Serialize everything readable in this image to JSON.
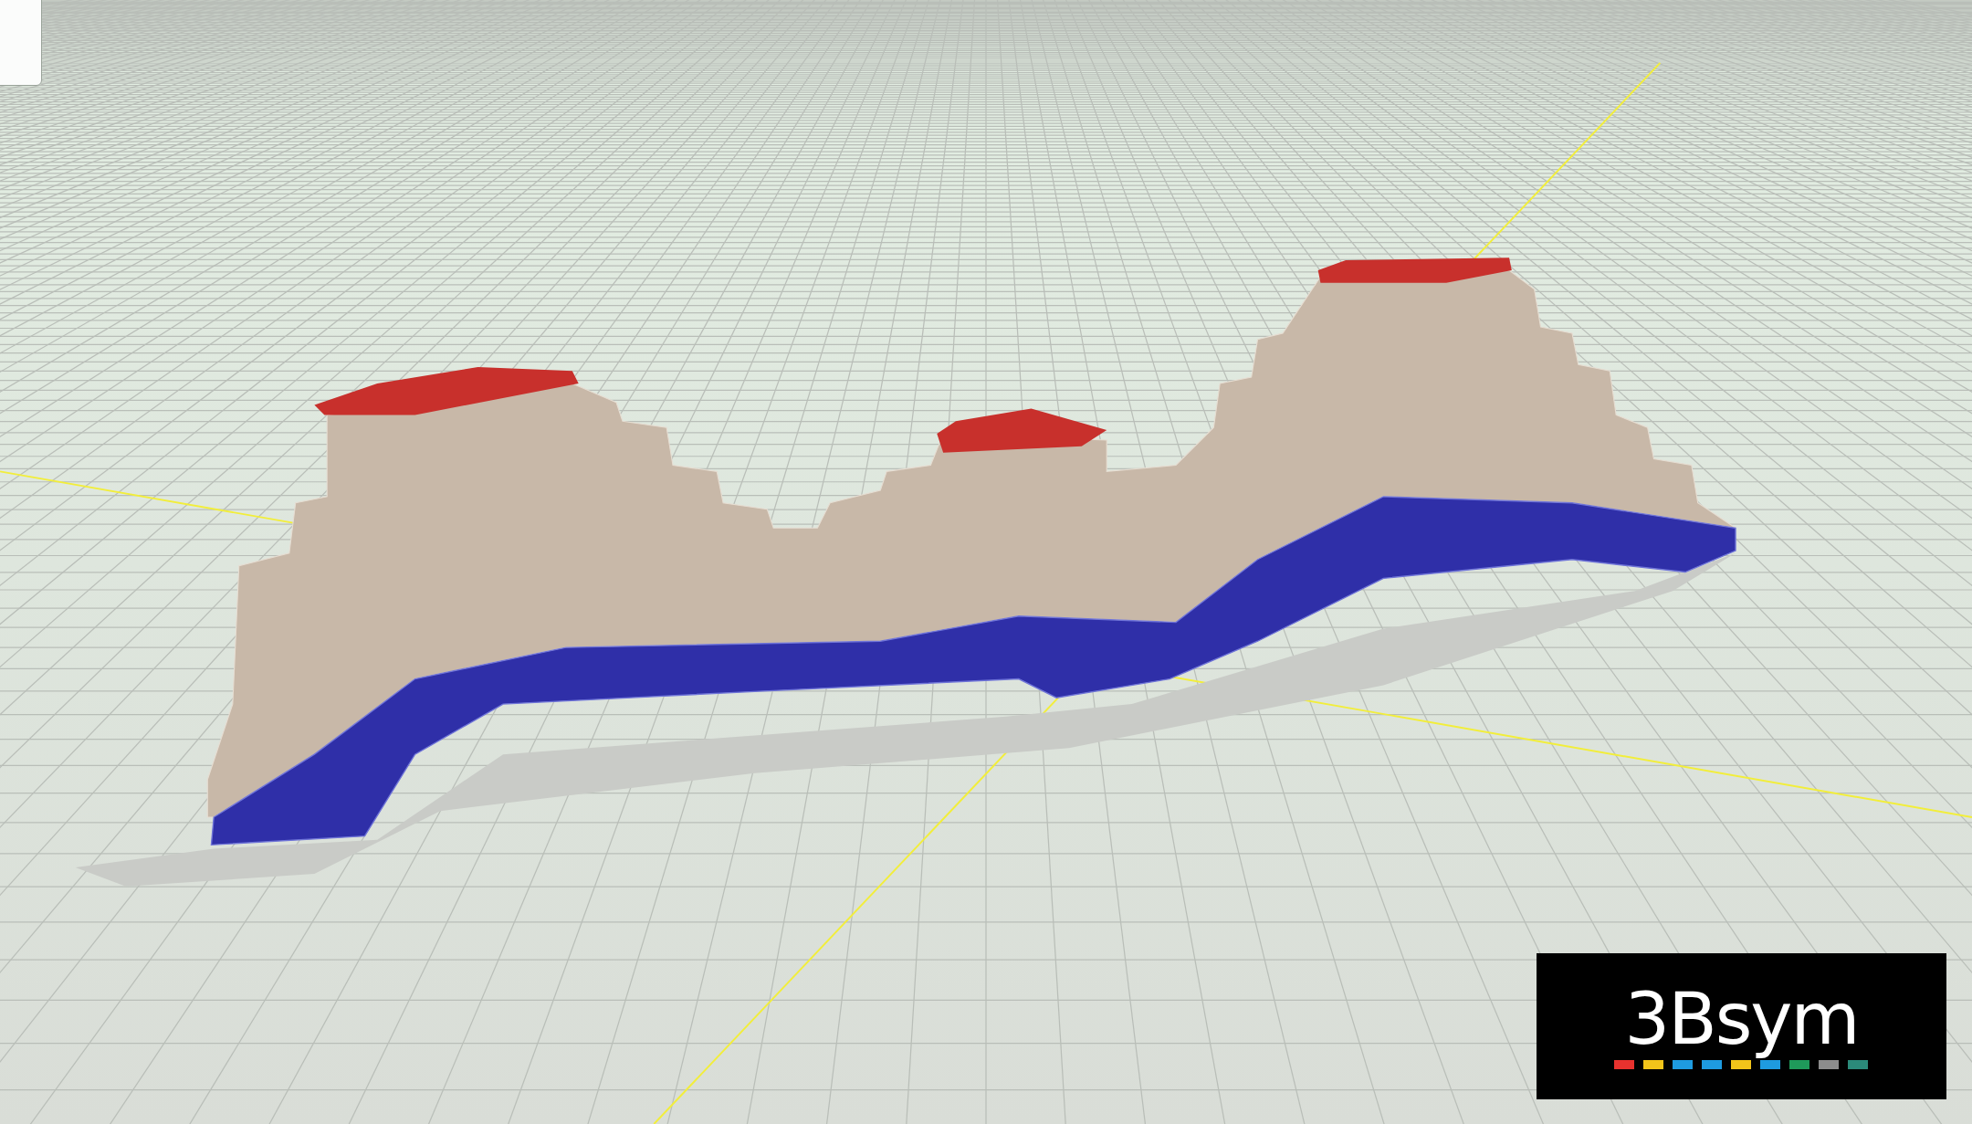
{
  "logo": {
    "text": "3Bsym"
  }
}
